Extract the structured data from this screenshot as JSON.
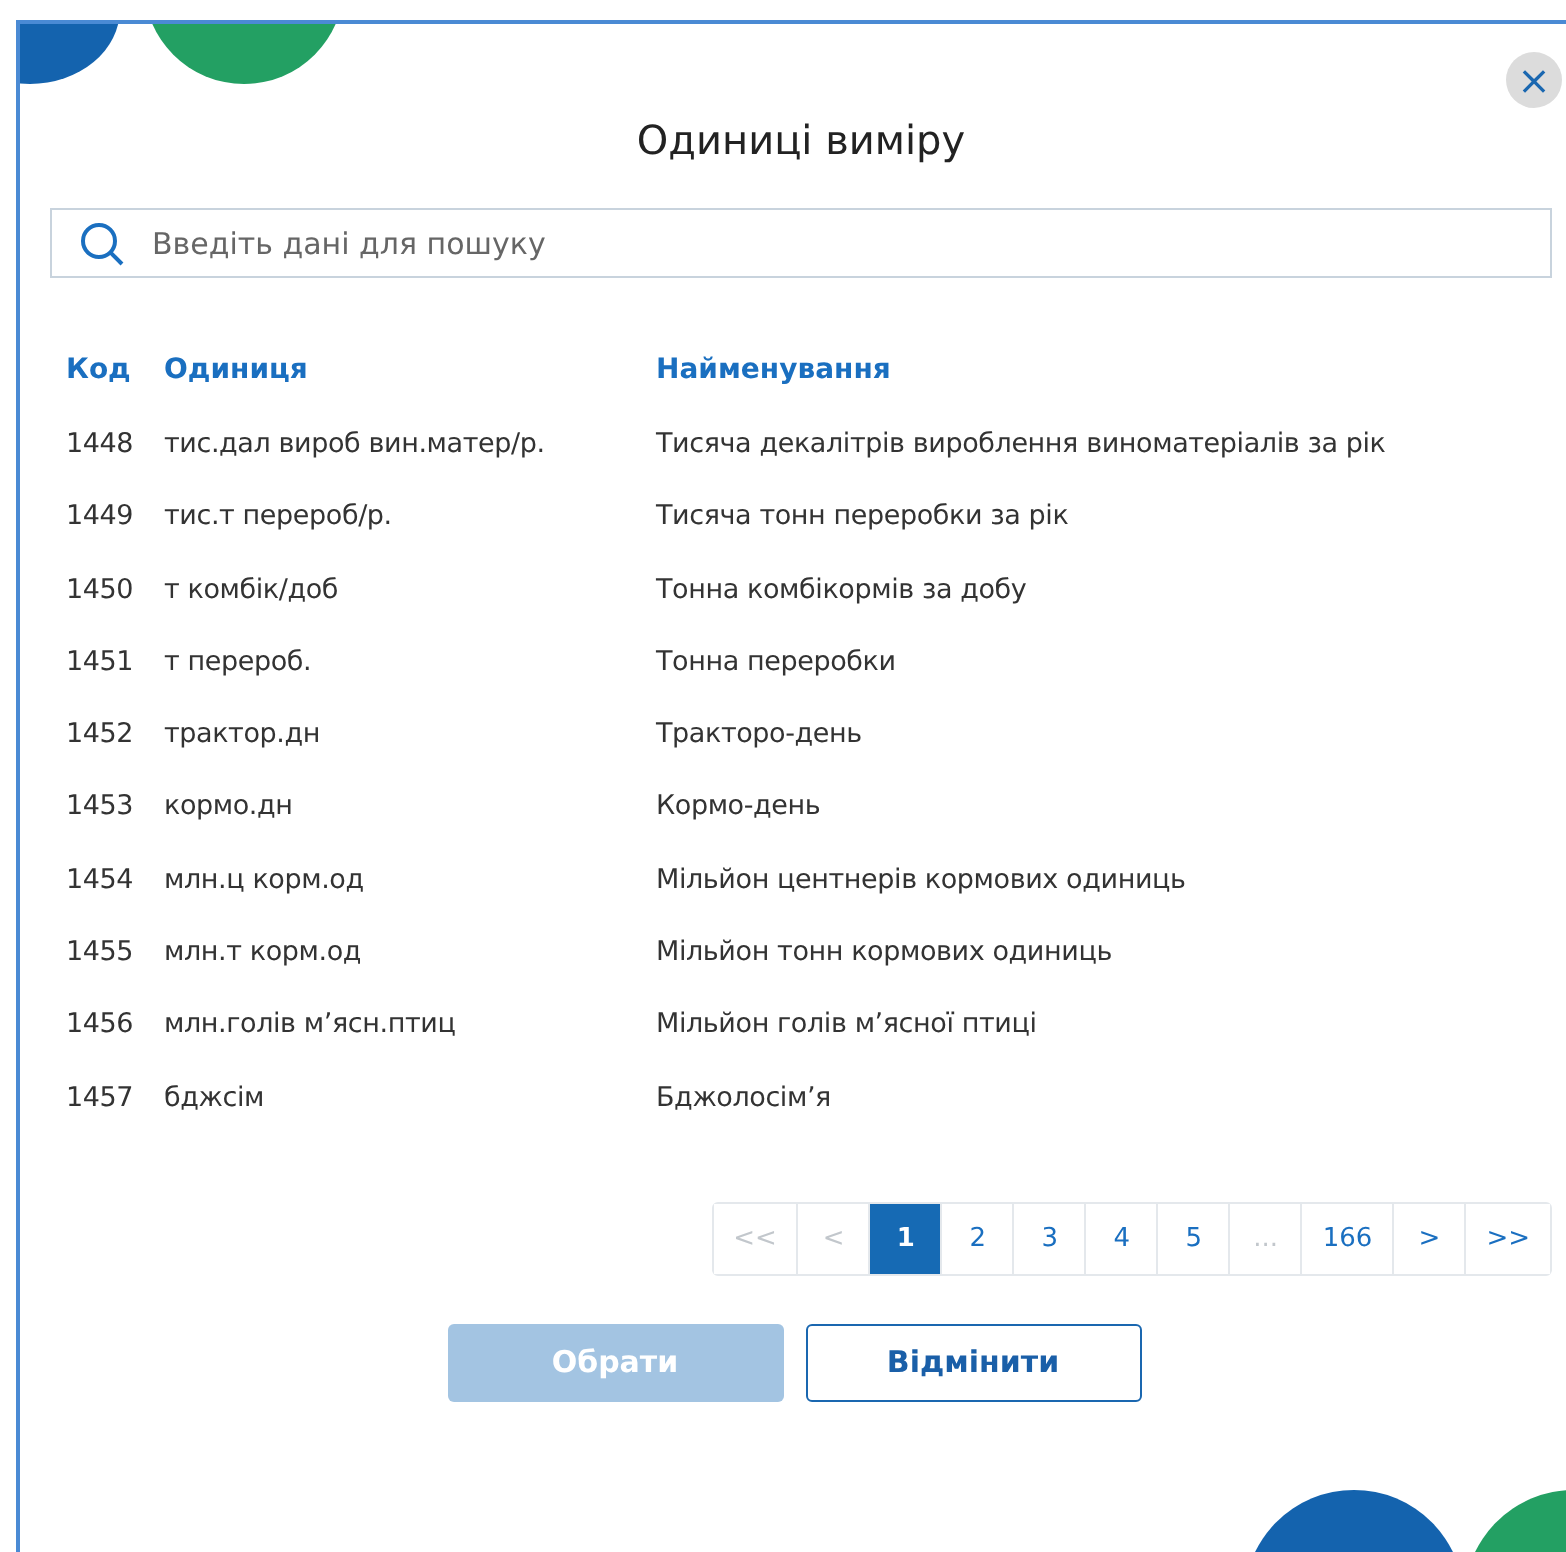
{
  "dialog": {
    "title": "Одиниці виміру",
    "close": "×"
  },
  "search": {
    "placeholder": "Введіть дані для пошуку"
  },
  "table": {
    "columns": [
      "Код",
      "Одиниця",
      "Найменування"
    ],
    "rows": [
      [
        "1448",
        "тис.дал вироб вин.матер/р.",
        "Тисяча декалітрів вироблення виноматеріалів за рік"
      ],
      [
        "1449",
        "тис.т перероб/р.",
        "Тисяча тонн переробки за рік"
      ],
      [
        "1450",
        "т комбік/доб",
        "Тонна комбікормів за добу"
      ],
      [
        "1451",
        "т перероб.",
        "Тонна переробки"
      ],
      [
        "1452",
        "трактор.дн",
        "Тракторо-день"
      ],
      [
        "1453",
        "кормо.дн",
        "Кормо-день"
      ],
      [
        "1454",
        "млн.ц корм.од",
        "Мільйон центнерів кормових одиниць"
      ],
      [
        "1455",
        "млн.т корм.од",
        "Мільйон тонн кормових одиниць"
      ],
      [
        "1456",
        "млн.голів м’ясн.птиц",
        "Мільйон голів м’ясної птиці"
      ],
      [
        "1457",
        "бджсім",
        "Бджолосім’я"
      ]
    ]
  },
  "pagination": [
    {
      "label": "<<",
      "selected": false,
      "disabled": true
    },
    {
      "label": "<",
      "selected": false,
      "disabled": true
    },
    {
      "label": "1",
      "selected": true,
      "disabled": false
    },
    {
      "label": "2",
      "selected": false,
      "disabled": false
    },
    {
      "label": "3",
      "selected": false,
      "disabled": false
    },
    {
      "label": "4",
      "selected": false,
      "disabled": false
    },
    {
      "label": "5",
      "selected": false,
      "disabled": false
    },
    {
      "label": "...",
      "selected": false,
      "disabled": true
    },
    {
      "label": "166",
      "selected": false,
      "disabled": false
    },
    {
      "label": ">",
      "selected": false,
      "disabled": false
    },
    {
      "label": ">>",
      "selected": false,
      "disabled": false
    }
  ],
  "buttons": [
    {
      "label": "Обрати",
      "kind": "primary",
      "disabled": true
    },
    {
      "label": "Відмінити",
      "kind": "outline",
      "disabled": false
    }
  ]
}
